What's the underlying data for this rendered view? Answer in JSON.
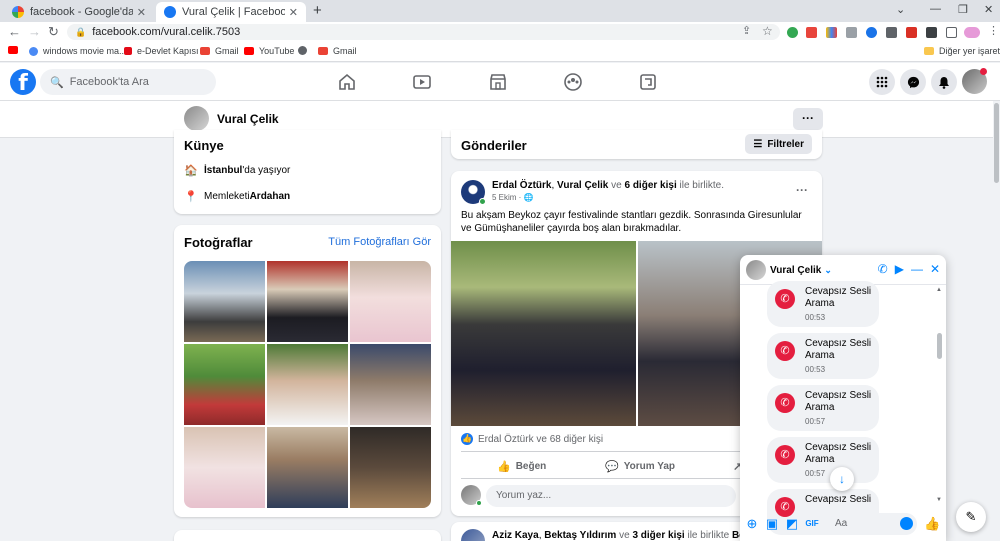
{
  "browser": {
    "tabs": [
      {
        "title": "facebook - Google'da Ara",
        "active": false,
        "favicon": "google-icon"
      },
      {
        "title": "Vural Çelik | Facebook",
        "active": true,
        "favicon": "facebook-icon"
      }
    ],
    "new_tab": "+",
    "url": "facebook.com/vural.celik.7503",
    "bookmarks": [
      {
        "label": "",
        "icon": "youtube-icon",
        "color": "#ff0000"
      },
      {
        "label": "windows movie ma...",
        "icon": "globe-icon",
        "color": "#4a8af4"
      },
      {
        "label": "e-Devlet Kapısı",
        "icon": "edevlet-icon",
        "color": "#e30a17"
      },
      {
        "label": "Gmail",
        "icon": "gmail-icon",
        "color": "#ea4335"
      },
      {
        "label": "YouTube",
        "icon": "youtube-icon",
        "color": "#ff0000"
      },
      {
        "label": "",
        "icon": "globe-icon",
        "color": "#5f6368"
      },
      {
        "label": "Gmail",
        "icon": "gmail-icon",
        "color": "#ea4335"
      }
    ],
    "other_bookmarks": "Diğer yer işaretleri"
  },
  "facebook": {
    "logo": "f",
    "search_placeholder": "Facebook'ta Ara",
    "profile_name": "Vural Çelik",
    "more_label": "···",
    "about": {
      "title": "Künye",
      "lives_prefix": "İstanbul",
      "lives_suffix": "'da yaşıyor",
      "hometown_prefix": "Memleketi ",
      "hometown": "Ardahan"
    },
    "photos": {
      "title": "Fotoğraflar",
      "all_link": "Tüm Fotoğrafları Gör"
    },
    "posts_header": {
      "title": "Gönderiler",
      "filters": "Filtreler"
    },
    "post1": {
      "author": "Erdal Öztürk",
      "sep": ", ",
      "with1": "Vural Çelik",
      "ve": " ve ",
      "others": "6 diğer kişi",
      "birlikte": " ile birlikte.",
      "date": "5 Ekim · ",
      "text": "Bu akşam Beykoz çayır festivalinde stantları gezdik. Sonrasında Giresunlular ve Gümüşhaneliler çayırda boş alan bırakmadılar.",
      "reactions": "Erdal Öztürk ve 68 diğer kişi",
      "like": "Beğen",
      "comment": "Yorum Yap",
      "comment_placeholder": "Yorum yaz...",
      "more": "···"
    },
    "post2": {
      "author": "Aziz Kaya",
      "sep": ", ",
      "with1": "Bektaş Yıldırım",
      "ve": " ve ",
      "others": "3 diğer kişi",
      "birlikte": " ile birlikte ",
      "extra": "Beyaz S..."
    }
  },
  "chat": {
    "name": "Vural Çelik",
    "messages": [
      {
        "title": "Cevapsız Sesli Arama",
        "time": "00:53"
      },
      {
        "title": "Cevapsız Sesli Arama",
        "time": "00:53"
      },
      {
        "title": "Cevapsız Sesli Arama",
        "time": "00:57"
      },
      {
        "title": "Cevapsız Sesli Arama",
        "time": "00:57"
      },
      {
        "title": "Cevapsız Sesli",
        "time": ""
      }
    ],
    "input_placeholder": "Aa"
  },
  "colors": {
    "fb_blue": "#1877f2",
    "messenger_blue": "#0084ff",
    "missed_red": "#e41e3f"
  }
}
